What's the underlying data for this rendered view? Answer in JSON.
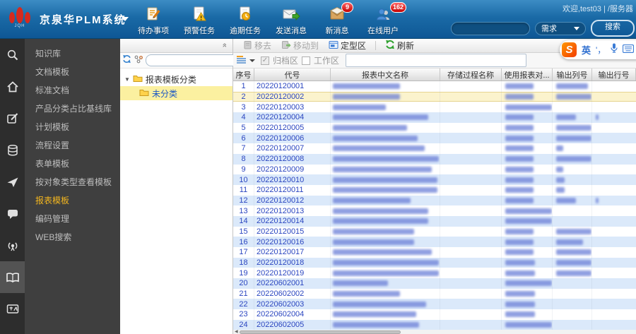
{
  "header": {
    "title": "京泉华PLM系统",
    "logo_sub": "JQH",
    "welcome": "欢迎,test03 | /服务器",
    "toolbar": [
      {
        "label": "待办事项",
        "badge": ""
      },
      {
        "label": "预警任务",
        "badge": ""
      },
      {
        "label": "逾期任务",
        "badge": ""
      },
      {
        "label": "发送消息",
        "badge": ""
      },
      {
        "label": "新消息",
        "badge": "9"
      },
      {
        "label": "在线用户",
        "badge": "162"
      }
    ],
    "search": {
      "value": "",
      "category": "需求",
      "button": "搜索"
    }
  },
  "menu": {
    "items": [
      {
        "label": "知识库",
        "active": false
      },
      {
        "label": "文档模板",
        "active": false
      },
      {
        "label": "标准文档",
        "active": false
      },
      {
        "label": "产品分类占比基线库",
        "active": false
      },
      {
        "label": "计划模板",
        "active": false
      },
      {
        "label": "流程设置",
        "active": false
      },
      {
        "label": "表单模板",
        "active": false
      },
      {
        "label": "按对象类型查看模板",
        "active": false
      },
      {
        "label": "报表模板",
        "active": true
      },
      {
        "label": "编码管理",
        "active": false
      },
      {
        "label": "WEB搜索",
        "active": false
      }
    ]
  },
  "tree": {
    "root": "报表模板分类",
    "selected": "未分类",
    "search_value": ""
  },
  "main": {
    "toolbar": {
      "remove": "移去",
      "move_to": "移动到",
      "fixed_area": "定型区",
      "refresh": "刷新"
    },
    "filter": {
      "archive": "归档区",
      "workspace": "工作区",
      "value": ""
    },
    "table": {
      "columns": [
        "序号",
        "代号",
        "报表中文名称",
        "存储过程名称",
        "使用报表对...",
        "输出列号",
        "输出行号"
      ],
      "rows": [
        {
          "seq": "1",
          "code": "20220120001",
          "selected": false,
          "blurs": {
            "name": 95,
            "user": 40,
            "col": 45,
            "row": 0
          }
        },
        {
          "seq": "2",
          "code": "20220120002",
          "selected": true,
          "blurs": {
            "name": 95,
            "user": 40,
            "col": 55,
            "row": 0
          }
        },
        {
          "seq": "3",
          "code": "20220120003",
          "selected": false,
          "blurs": {
            "name": 75,
            "user": 68,
            "col": 0,
            "row": 0
          }
        },
        {
          "seq": "4",
          "code": "20220120004",
          "selected": false,
          "blurs": {
            "name": 135,
            "user": 40,
            "col": 28,
            "row": 4
          }
        },
        {
          "seq": "5",
          "code": "20220120005",
          "selected": false,
          "blurs": {
            "name": 105,
            "user": 40,
            "col": 58,
            "row": 0
          }
        },
        {
          "seq": "6",
          "code": "20220120006",
          "selected": false,
          "blurs": {
            "name": 120,
            "user": 40,
            "col": 58,
            "row": 0
          }
        },
        {
          "seq": "7",
          "code": "20220120007",
          "selected": false,
          "blurs": {
            "name": 130,
            "user": 40,
            "col": 10,
            "row": 0
          }
        },
        {
          "seq": "8",
          "code": "20220120008",
          "selected": false,
          "blurs": {
            "name": 150,
            "user": 40,
            "col": 62,
            "row": 0
          }
        },
        {
          "seq": "9",
          "code": "20220120009",
          "selected": false,
          "blurs": {
            "name": 140,
            "user": 40,
            "col": 10,
            "row": 0
          }
        },
        {
          "seq": "10",
          "code": "20220120010",
          "selected": false,
          "blurs": {
            "name": 148,
            "user": 40,
            "col": 12,
            "row": 0
          }
        },
        {
          "seq": "11",
          "code": "20220120011",
          "selected": false,
          "blurs": {
            "name": 148,
            "user": 40,
            "col": 12,
            "row": 0
          }
        },
        {
          "seq": "12",
          "code": "20220120012",
          "selected": false,
          "blurs": {
            "name": 110,
            "user": 40,
            "col": 28,
            "row": 4
          }
        },
        {
          "seq": "13",
          "code": "20220120013",
          "selected": false,
          "blurs": {
            "name": 135,
            "user": 66,
            "col": 0,
            "row": 0
          }
        },
        {
          "seq": "14",
          "code": "20220120014",
          "selected": false,
          "blurs": {
            "name": 135,
            "user": 66,
            "col": 0,
            "row": 0
          }
        },
        {
          "seq": "15",
          "code": "20220120015",
          "selected": false,
          "blurs": {
            "name": 115,
            "user": 40,
            "col": 58,
            "row": 0
          }
        },
        {
          "seq": "16",
          "code": "20220120016",
          "selected": false,
          "blurs": {
            "name": 115,
            "user": 40,
            "col": 38,
            "row": 0
          }
        },
        {
          "seq": "17",
          "code": "20220120017",
          "selected": false,
          "blurs": {
            "name": 140,
            "user": 40,
            "col": 60,
            "row": 0
          }
        },
        {
          "seq": "18",
          "code": "20220120018",
          "selected": false,
          "blurs": {
            "name": 150,
            "user": 42,
            "col": 56,
            "row": 0
          }
        },
        {
          "seq": "19",
          "code": "20220120019",
          "selected": false,
          "blurs": {
            "name": 150,
            "user": 42,
            "col": 56,
            "row": 0
          }
        },
        {
          "seq": "20",
          "code": "20220602001",
          "selected": false,
          "blurs": {
            "name": 78,
            "user": 66,
            "col": 0,
            "row": 0
          }
        },
        {
          "seq": "21",
          "code": "20220602002",
          "selected": false,
          "blurs": {
            "name": 95,
            "user": 42,
            "col": 0,
            "row": 0
          }
        },
        {
          "seq": "22",
          "code": "20220602003",
          "selected": false,
          "blurs": {
            "name": 132,
            "user": 42,
            "col": 0,
            "row": 0
          }
        },
        {
          "seq": "23",
          "code": "20220602004",
          "selected": false,
          "blurs": {
            "name": 118,
            "user": 42,
            "col": 0,
            "row": 0
          }
        },
        {
          "seq": "24",
          "code": "20220602005",
          "selected": false,
          "blurs": {
            "name": 122,
            "user": 66,
            "col": 0,
            "row": 0
          }
        }
      ]
    }
  },
  "ime": {
    "logo": "S",
    "lang": "英",
    "punct": "'，"
  }
}
